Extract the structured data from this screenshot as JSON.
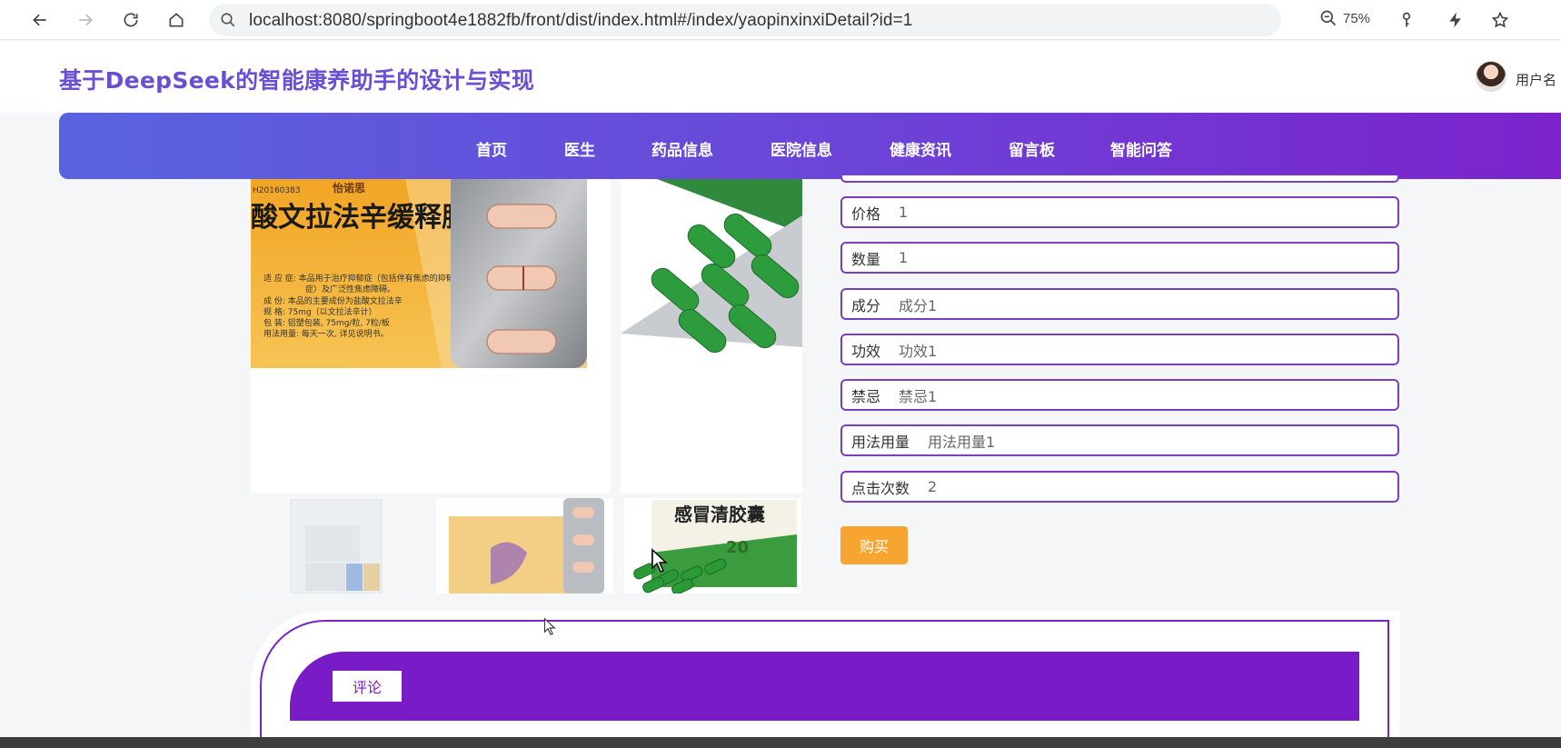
{
  "browser": {
    "url": "localhost:8080/springboot4e1882fb/front/dist/index.html#/index/yaopinxinxiDetail?id=1",
    "zoom": "75%"
  },
  "header": {
    "site_title": "基于DeepSeek的智能康养助手的设计与实现",
    "username": "用户名"
  },
  "nav": {
    "items": [
      "首页",
      "医生",
      "药品信息",
      "医院信息",
      "健康资讯",
      "留言板",
      "智能问答"
    ]
  },
  "product": {
    "main_image": {
      "brand": "怡诺思",
      "name": "盐酸文拉法辛缓释胶囊",
      "code": "H20160383",
      "desc_lines": [
        "适 应 症: 本品用于治疗抑郁症（包括伴有焦虑的抑郁",
        "症）及广泛性焦虑障碍。",
        "成    份: 本品的主要成份为盐酸文拉法辛",
        "规    格: 75mg（以文拉法辛计）",
        "包    装: 铝塑包装, 75mg/粒, 7粒/板",
        "用法用量: 每天一次, 详见说明书。"
      ]
    },
    "thumb3_name": "感冒清胶囊",
    "thumb3_count": "20"
  },
  "details": [
    {
      "label": "价格",
      "value": "1"
    },
    {
      "label": "数量",
      "value": "1"
    },
    {
      "label": "成分",
      "value": "成分1"
    },
    {
      "label": "功效",
      "value": "功效1"
    },
    {
      "label": "禁忌",
      "value": "禁忌1"
    },
    {
      "label": "用法用量",
      "value": "用法用量1"
    },
    {
      "label": "点击次数",
      "value": "2"
    }
  ],
  "actions": {
    "buy_label": "购买"
  },
  "comments": {
    "tab_label": "评论"
  },
  "colors": {
    "accent_purple": "#7a1bc8",
    "nav_gradient_start": "#5863e0",
    "title_color": "#6a4fd4",
    "buy_button": "#f7a531"
  }
}
